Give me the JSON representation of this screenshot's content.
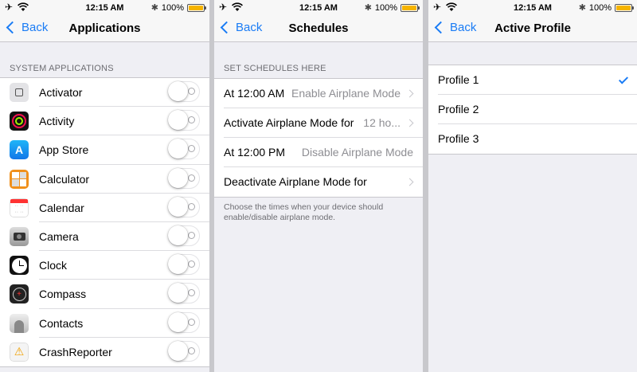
{
  "status_bar": {
    "time": "12:15 AM",
    "battery_text": "100%",
    "battery_level": 1.0,
    "battery_color": "#f5b400"
  },
  "panel1": {
    "back_label": "Back",
    "title": "Applications",
    "section_header": "SYSTEM APPLICATIONS",
    "apps": [
      {
        "label": "Activator",
        "icon": "activator-icon",
        "enabled": false
      },
      {
        "label": "Activity",
        "icon": "activity-icon",
        "enabled": false
      },
      {
        "label": "App Store",
        "icon": "app-store-icon",
        "enabled": false
      },
      {
        "label": "Calculator",
        "icon": "calculator-icon",
        "enabled": false
      },
      {
        "label": "Calendar",
        "icon": "calendar-icon",
        "enabled": false
      },
      {
        "label": "Camera",
        "icon": "camera-icon",
        "enabled": false
      },
      {
        "label": "Clock",
        "icon": "clock-icon",
        "enabled": false
      },
      {
        "label": "Compass",
        "icon": "compass-icon",
        "enabled": false
      },
      {
        "label": "Contacts",
        "icon": "contacts-icon",
        "enabled": false
      },
      {
        "label": "CrashReporter",
        "icon": "crash-reporter-icon",
        "enabled": false
      }
    ]
  },
  "panel2": {
    "back_label": "Back",
    "title": "Schedules",
    "section_header": "SET SCHEDULES HERE",
    "rows": [
      {
        "label": "At 12:00 AM",
        "value": "Enable Airplane Mode",
        "has_arrow": true
      },
      {
        "label": "Activate Airplane Mode for",
        "value": "12 ho...",
        "has_arrow": true
      },
      {
        "label": "At 12:00 PM",
        "value": "Disable Airplane Mode",
        "has_arrow": false
      },
      {
        "label": "Deactivate Airplane Mode for",
        "value": "",
        "has_arrow": true
      }
    ],
    "footer": "Choose the times when your device should enable/disable airplane mode."
  },
  "panel3": {
    "back_label": "Back",
    "title": "Active Profile",
    "profiles": [
      {
        "label": "Profile 1",
        "selected": true
      },
      {
        "label": "Profile 2",
        "selected": false
      },
      {
        "label": "Profile 3",
        "selected": false
      }
    ]
  },
  "colors": {
    "accent": "#1a7cf5",
    "background": "#efeff4",
    "secondary_text": "#8e8e93"
  }
}
